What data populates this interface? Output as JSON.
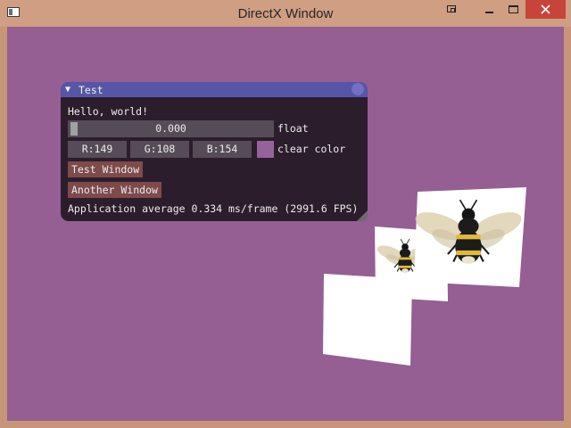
{
  "window": {
    "title": "DirectX Window"
  },
  "imgui": {
    "title": "Test",
    "collapse_glyph": "▼",
    "hello_text": "Hello, world!",
    "slider": {
      "value_text": "0.000",
      "value": 0.0,
      "label": "float"
    },
    "color": {
      "r_text": "R:149",
      "g_text": "G:108",
      "b_text": "B:154",
      "label": "clear color",
      "swatch_hex": "#955f93"
    },
    "buttons": {
      "test_window": "Test Window",
      "another_window": "Another Window"
    },
    "status_text": "Application average 0.334 ms/frame (2991.6 FPS)"
  },
  "colors": {
    "frame": "#cf9e83",
    "clear": "#955f93",
    "imgui_bg": "#2c1d2d",
    "imgui_title": "#5655a6",
    "button": "#7e4a4c",
    "close_button": "#c7443b"
  },
  "icons": {
    "app": "app-window-icon",
    "restore": "restore-icon",
    "minimize": "minimize-icon",
    "maximize": "maximize-icon",
    "close": "close-icon",
    "imgui_close": "circle-icon",
    "resize": "resize-grip-icon"
  }
}
